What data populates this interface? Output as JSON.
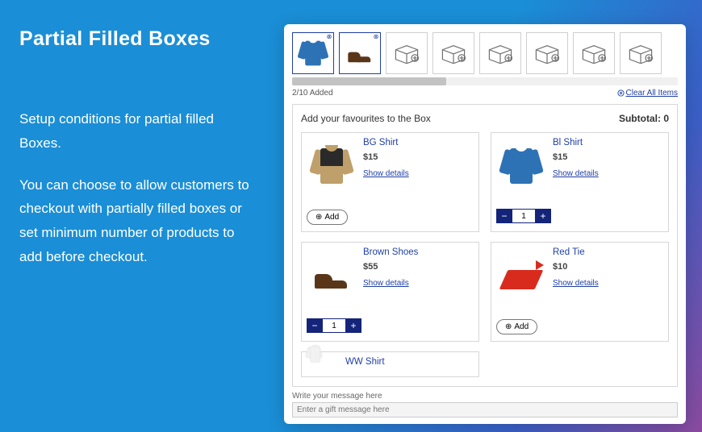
{
  "left": {
    "title": "Partial Filled Boxes",
    "p1": "Setup conditions for partial filled Boxes.",
    "p2": "You can choose to allow customers to checkout with partially filled boxes or set minimum number of products to add before checkout."
  },
  "slots": {
    "added_text": "2/10 Added",
    "clear_text": "Clear All Items"
  },
  "box": {
    "header_text": "Add your favourites to the Box",
    "subtotal_label": "Subtotal:",
    "subtotal_value": "0"
  },
  "products": {
    "bg": {
      "name": "BG Shirt",
      "price": "$15",
      "details": "Show details",
      "add_label": "Add"
    },
    "bl": {
      "name": "Bl Shirt",
      "price": "$15",
      "details": "Show details",
      "qty": "1"
    },
    "brown": {
      "name": "Brown Shoes",
      "price": "$55",
      "details": "Show details",
      "qty": "1"
    },
    "red": {
      "name": "Red Tie",
      "price": "$10",
      "details": "Show details",
      "add_label": "Add"
    },
    "ww": {
      "name": "WW Shirt"
    }
  },
  "message": {
    "label": "Write your message here",
    "placeholder": "Enter a gift message here"
  }
}
